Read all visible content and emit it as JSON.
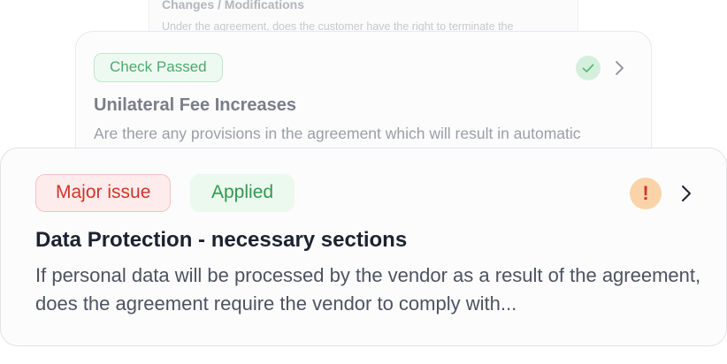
{
  "cards": [
    {
      "title": "Changes / Modifications",
      "description": "Under the agreement, does the customer have the right to terminate the"
    },
    {
      "badge": "Check Passed",
      "status_icon": "check-icon",
      "title": "Unilateral Fee Increases",
      "description": "Are there any provisions in the agreement which will result in automatic"
    },
    {
      "badges": [
        "Major issue",
        "Applied"
      ],
      "status_icon": "exclamation-icon",
      "status_glyph": "!",
      "title": "Data Protection - necessary sections",
      "description": "If personal data will be processed by the vendor as a result of the agreement, does the agreement require the vendor to comply with..."
    }
  ],
  "colors": {
    "passed_bg": "#eefaf1",
    "passed_text": "#4fa96b",
    "major_bg": "#fdeceb",
    "major_text": "#d3342b",
    "applied_bg": "#ecf9ef",
    "applied_text": "#2f9a4f",
    "warning_icon_bg": "#fbd3a8"
  }
}
